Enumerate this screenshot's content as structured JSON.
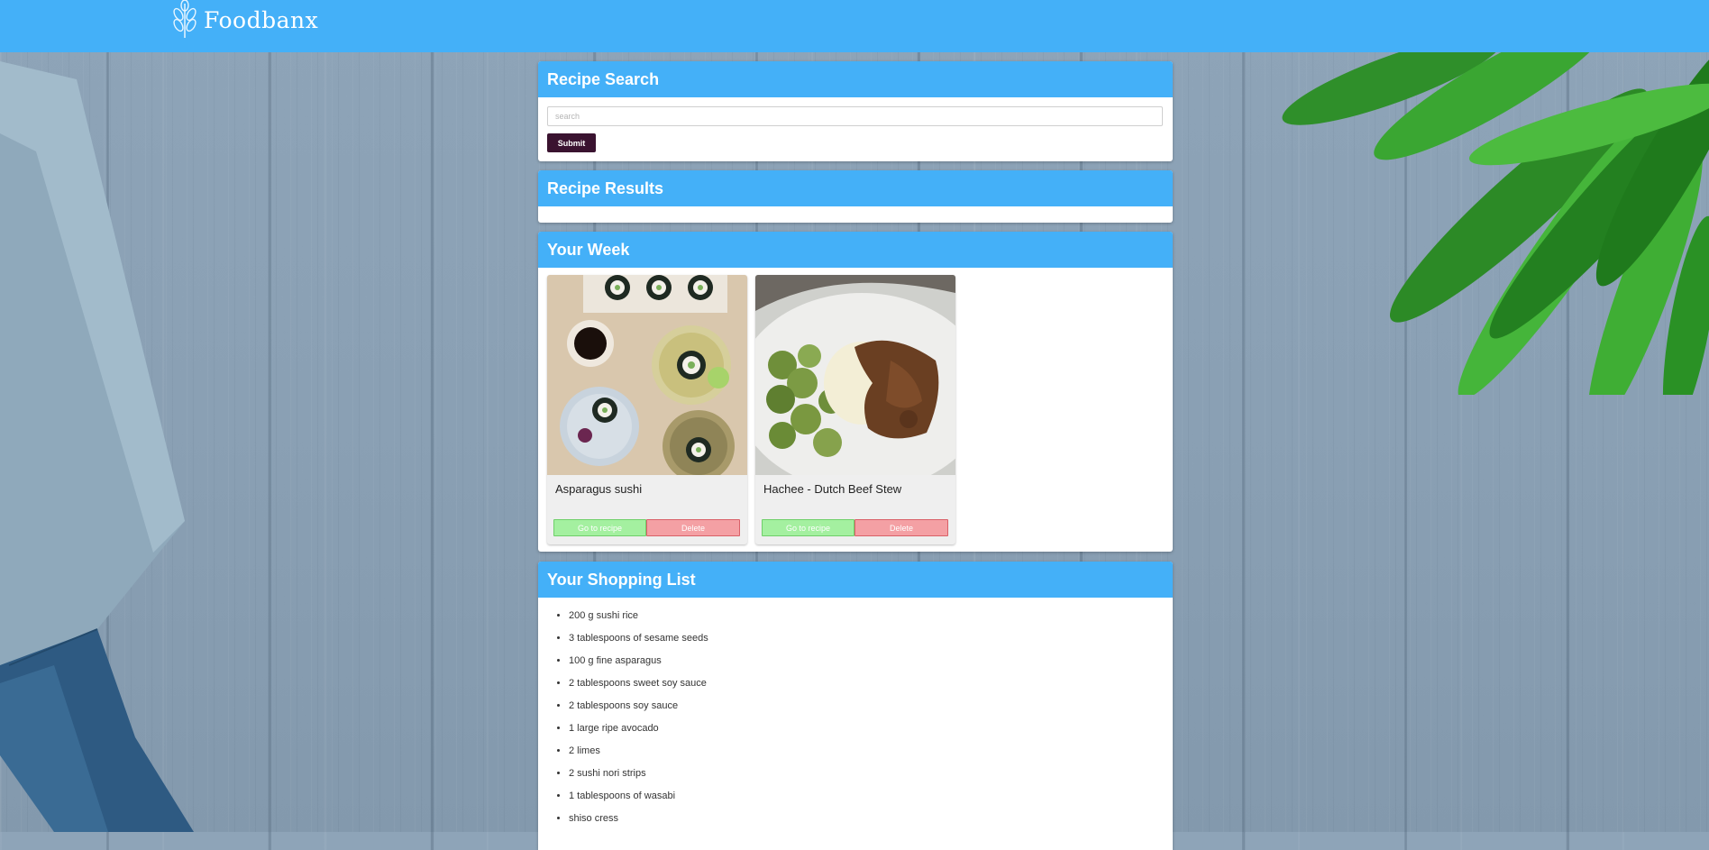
{
  "brand": {
    "name": "Foodbanx",
    "logo_icon": "wheat-leaf-icon"
  },
  "colors": {
    "primary": "#44b0f8",
    "submit": "#3a1330",
    "go_button": "#a4f0a0",
    "delete_button": "#f4a0a4",
    "background": "#8ea4b8"
  },
  "search": {
    "heading": "Recipe Search",
    "placeholder": "search",
    "value": "",
    "submit_label": "Submit"
  },
  "results": {
    "heading": "Recipe Results"
  },
  "week": {
    "heading": "Your Week",
    "recipes": [
      {
        "title": "Asparagus sushi",
        "go_label": "Go to recipe",
        "delete_label": "Delete"
      },
      {
        "title": "Hachee - Dutch Beef Stew",
        "go_label": "Go to recipe",
        "delete_label": "Delete"
      }
    ]
  },
  "shopping": {
    "heading": "Your Shopping List",
    "items": [
      "200 g sushi rice",
      "3 tablespoons of sesame seeds",
      "100 g fine asparagus",
      "2 tablespoons sweet soy sauce",
      "2 tablespoons soy sauce",
      "1 large ripe avocado",
      "2 limes",
      "2 sushi nori strips",
      "1 tablespoons of wasabi",
      "shiso cress"
    ]
  }
}
